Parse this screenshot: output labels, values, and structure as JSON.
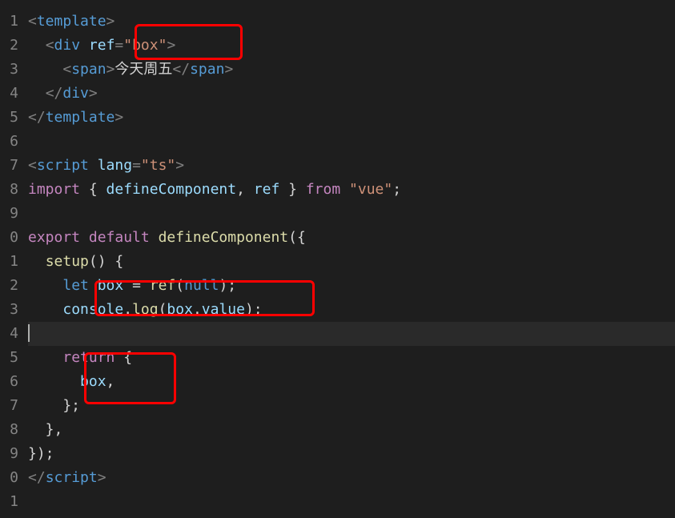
{
  "lineNumbers": [
    "1",
    "2",
    "3",
    "4",
    "5",
    "6",
    "7",
    "8",
    "9",
    "0",
    "1",
    "2",
    "3",
    "4",
    "5",
    "6",
    "7",
    "8",
    "9",
    "0",
    "1"
  ],
  "tokens": {
    "l1": [
      [
        "s-punc",
        "<"
      ],
      [
        "s-tag",
        "template"
      ],
      [
        "s-punc",
        ">"
      ]
    ],
    "l2": [
      [
        "s-plain",
        "  "
      ],
      [
        "s-punc",
        "<"
      ],
      [
        "s-tag",
        "div"
      ],
      [
        "s-plain",
        " "
      ],
      [
        "s-attr",
        "ref"
      ],
      [
        "s-punc",
        "="
      ],
      [
        "s-str",
        "\"box\""
      ],
      [
        "s-punc",
        ">"
      ]
    ],
    "l3": [
      [
        "s-plain",
        "    "
      ],
      [
        "s-punc",
        "<"
      ],
      [
        "s-tag",
        "span"
      ],
      [
        "s-punc",
        ">"
      ],
      [
        "s-txt",
        "今天周五"
      ],
      [
        "s-punc",
        "</"
      ],
      [
        "s-tag",
        "span"
      ],
      [
        "s-punc",
        ">"
      ]
    ],
    "l4": [
      [
        "s-plain",
        "  "
      ],
      [
        "s-punc",
        "</"
      ],
      [
        "s-tag",
        "div"
      ],
      [
        "s-punc",
        ">"
      ]
    ],
    "l5": [
      [
        "s-punc",
        "</"
      ],
      [
        "s-tag",
        "template"
      ],
      [
        "s-punc",
        ">"
      ]
    ],
    "l6": [],
    "l7": [
      [
        "s-punc",
        "<"
      ],
      [
        "s-tag",
        "script"
      ],
      [
        "s-plain",
        " "
      ],
      [
        "s-attr",
        "lang"
      ],
      [
        "s-punc",
        "="
      ],
      [
        "s-str",
        "\"ts\""
      ],
      [
        "s-punc",
        ">"
      ]
    ],
    "l8": [
      [
        "s-kwmod",
        "import"
      ],
      [
        "s-plain",
        " { "
      ],
      [
        "s-var",
        "defineComponent"
      ],
      [
        "s-plain",
        ", "
      ],
      [
        "s-var",
        "ref"
      ],
      [
        "s-plain",
        " } "
      ],
      [
        "s-kwmod",
        "from"
      ],
      [
        "s-plain",
        " "
      ],
      [
        "s-str",
        "\"vue\""
      ],
      [
        "s-plain",
        ";"
      ]
    ],
    "l9": [],
    "l10": [
      [
        "s-kwmod",
        "export"
      ],
      [
        "s-plain",
        " "
      ],
      [
        "s-kwmod",
        "default"
      ],
      [
        "s-plain",
        " "
      ],
      [
        "s-fn",
        "defineComponent"
      ],
      [
        "s-plain",
        "({"
      ]
    ],
    "l11": [
      [
        "s-plain",
        "  "
      ],
      [
        "s-fn",
        "setup"
      ],
      [
        "s-plain",
        "() {"
      ]
    ],
    "l12": [
      [
        "s-plain",
        "    "
      ],
      [
        "s-kw",
        "let"
      ],
      [
        "s-plain",
        " "
      ],
      [
        "s-var",
        "box"
      ],
      [
        "s-plain",
        " = "
      ],
      [
        "s-fn",
        "ref"
      ],
      [
        "s-plain",
        "("
      ],
      [
        "s-null",
        "null"
      ],
      [
        "s-plain",
        ");"
      ]
    ],
    "l13": [
      [
        "s-plain",
        "    "
      ],
      [
        "s-var",
        "console"
      ],
      [
        "s-plain",
        "."
      ],
      [
        "s-fn",
        "log"
      ],
      [
        "s-plain",
        "("
      ],
      [
        "s-var",
        "box"
      ],
      [
        "s-plain",
        "."
      ],
      [
        "s-var",
        "value"
      ],
      [
        "s-plain",
        ");"
      ]
    ],
    "l14": [],
    "l15": [
      [
        "s-plain",
        "    "
      ],
      [
        "s-kwmod",
        "return"
      ],
      [
        "s-plain",
        " {"
      ]
    ],
    "l16": [
      [
        "s-plain",
        "      "
      ],
      [
        "s-var",
        "box"
      ],
      [
        "s-plain",
        ","
      ]
    ],
    "l17": [
      [
        "s-plain",
        "    };"
      ]
    ],
    "l18": [
      [
        "s-plain",
        "  },"
      ]
    ],
    "l19": [
      [
        "s-plain",
        "});"
      ]
    ],
    "l20": [
      [
        "s-punc",
        "</"
      ],
      [
        "s-tag",
        "script"
      ],
      [
        "s-punc",
        ">"
      ]
    ],
    "l21": []
  },
  "activeLine": 14,
  "highlights": [
    "hb1",
    "hb2",
    "hb3"
  ]
}
